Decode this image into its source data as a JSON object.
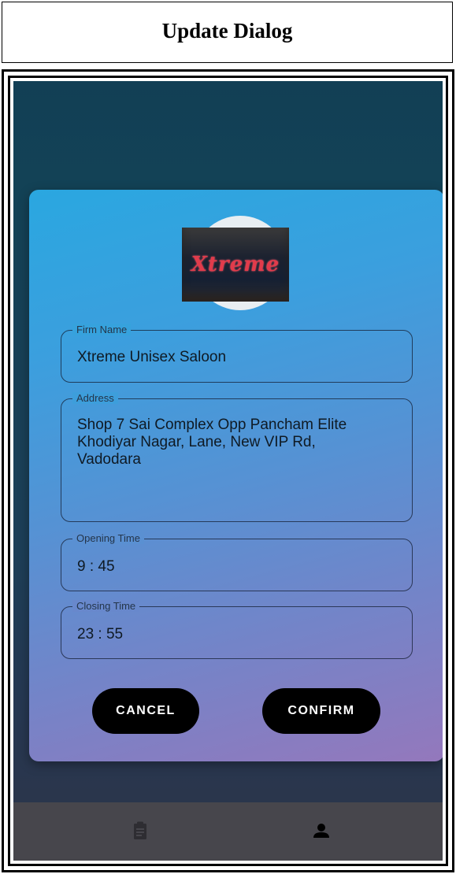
{
  "caption": "Update Dialog",
  "dialog": {
    "logo_alt": "Xtreme",
    "fields": {
      "firm_name": {
        "label": "Firm Name",
        "value": "Xtreme Unisex Saloon"
      },
      "address": {
        "label": "Address",
        "value": "Shop 7 Sai Complex Opp Pancham Elite\nKhodiyar Nagar, Lane, New VIP Rd,\nVadodara"
      },
      "opening_time": {
        "label": "Opening Time",
        "value": "9 : 45"
      },
      "closing_time": {
        "label": "Closing Time",
        "value": "23 : 55"
      }
    },
    "cancel_label": "CANCEL",
    "confirm_label": "CONFIRM"
  },
  "bottom_nav": {
    "items": [
      {
        "icon": "clipboard-icon"
      },
      {
        "icon": "person-icon"
      }
    ]
  },
  "colors": {
    "dialog_top": "#2aa7e0",
    "dialog_bottom": "#9478bc",
    "button_bg": "#000000",
    "nav_bar": "#47464c"
  }
}
